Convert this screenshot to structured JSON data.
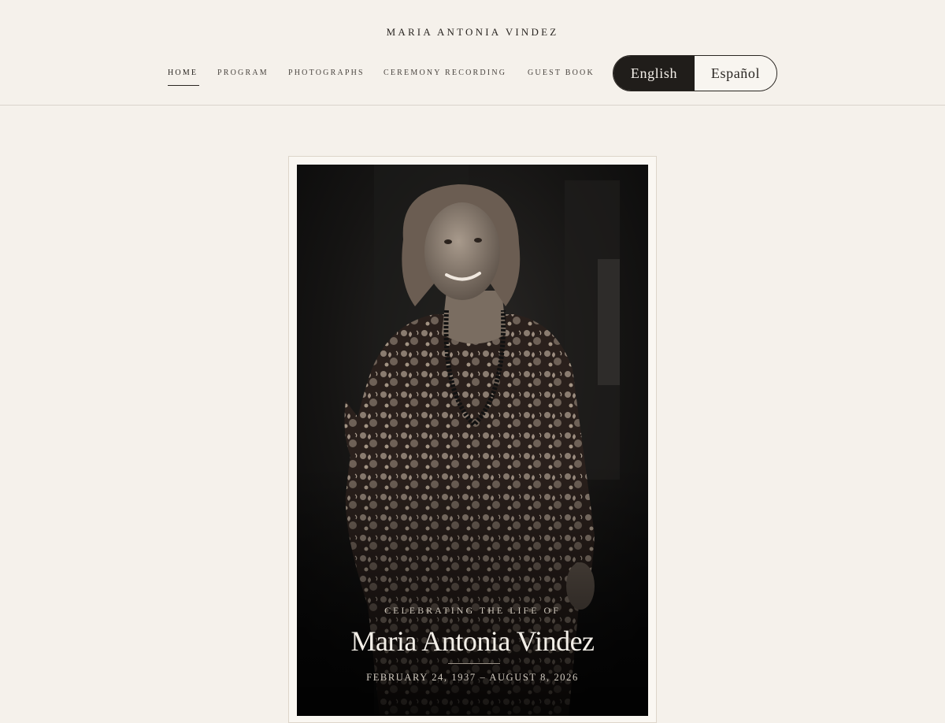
{
  "site": {
    "title": "MARIA ANTONIA VINDEZ"
  },
  "nav": {
    "items": [
      {
        "label": "HOME",
        "active": true
      },
      {
        "label": "PROGRAM",
        "active": false
      },
      {
        "label": "PHOTOGRAPHS",
        "active": false
      },
      {
        "label": "CEREMONY RECORDING",
        "active": false
      },
      {
        "label": "GUEST BOOK",
        "active": false
      }
    ]
  },
  "language": {
    "options": [
      "English",
      "Español"
    ],
    "selected": "English"
  },
  "hero": {
    "eyebrow": "CELEBRATING THE LIFE OF",
    "name": "Maria Antonia Vindez",
    "dates": "FEBRUARY 24, 1937 – AUGUST 8, 2026"
  },
  "colors": {
    "background": "#f5f1eb",
    "text": "#2a2622",
    "toggle_active_bg": "#201d1a"
  }
}
